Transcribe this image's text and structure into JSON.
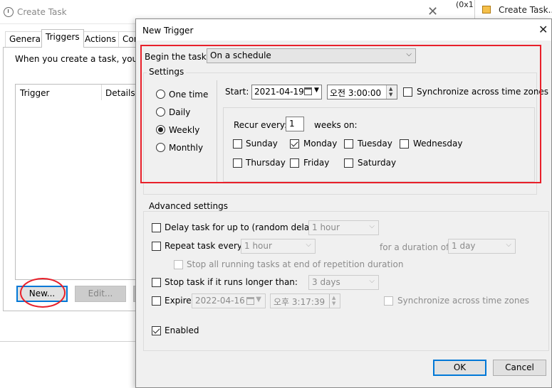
{
  "background_window": {
    "title": "Create Task",
    "close_glyph": "✕",
    "tabs": [
      "General",
      "Triggers",
      "Actions",
      "Con"
    ],
    "description": "When you create a task, you can",
    "list_columns": [
      "Trigger",
      "Details"
    ],
    "new_button": "New...",
    "edit_button": "Edit...",
    "partial_label": "(0x1"
  },
  "second_window": {
    "title": "Create Task..."
  },
  "dialog": {
    "title": "New Trigger",
    "close_glyph": "✕",
    "begin_label": "Begin the task:",
    "begin_value": "On a schedule",
    "settings": {
      "label": "Settings",
      "options": [
        "One time",
        "Daily",
        "Weekly",
        "Monthly"
      ],
      "selected": "Weekly",
      "start_label": "Start:",
      "start_date": "2021-04-19",
      "start_time": "오전  3:00:00",
      "sync_label": "Synchronize across time zones",
      "recur_label": "Recur every:",
      "recur_value": "1",
      "weeks_on": "weeks on:",
      "days": [
        {
          "name": "Sunday",
          "checked": false
        },
        {
          "name": "Monday",
          "checked": true
        },
        {
          "name": "Tuesday",
          "checked": false
        },
        {
          "name": "Wednesday",
          "checked": false
        },
        {
          "name": "Thursday",
          "checked": false
        },
        {
          "name": "Friday",
          "checked": false
        },
        {
          "name": "Saturday",
          "checked": false
        }
      ]
    },
    "advanced": {
      "label": "Advanced settings",
      "delay_label": "Delay task for up to (random delay):",
      "delay_value": "1 hour",
      "repeat_label": "Repeat task every:",
      "repeat_value": "1 hour",
      "duration_label": "for a duration of:",
      "duration_value": "1 day",
      "stop_all_label": "Stop all running tasks at end of repetition duration",
      "stop_longer_label": "Stop task if it runs longer than:",
      "stop_longer_value": "3 days",
      "expire_label": "Expire:",
      "expire_date": "2022-04-16",
      "expire_time": "오후  3:17:39",
      "expire_sync_label": "Synchronize across time zones",
      "enabled_label": "Enabled",
      "enabled_checked": true
    },
    "ok_button": "OK",
    "cancel_button": "Cancel"
  },
  "colors": {
    "annotation": "#e8202a",
    "focus_blue": "#0078d7",
    "dialog_bg": "#f0f0f0"
  }
}
